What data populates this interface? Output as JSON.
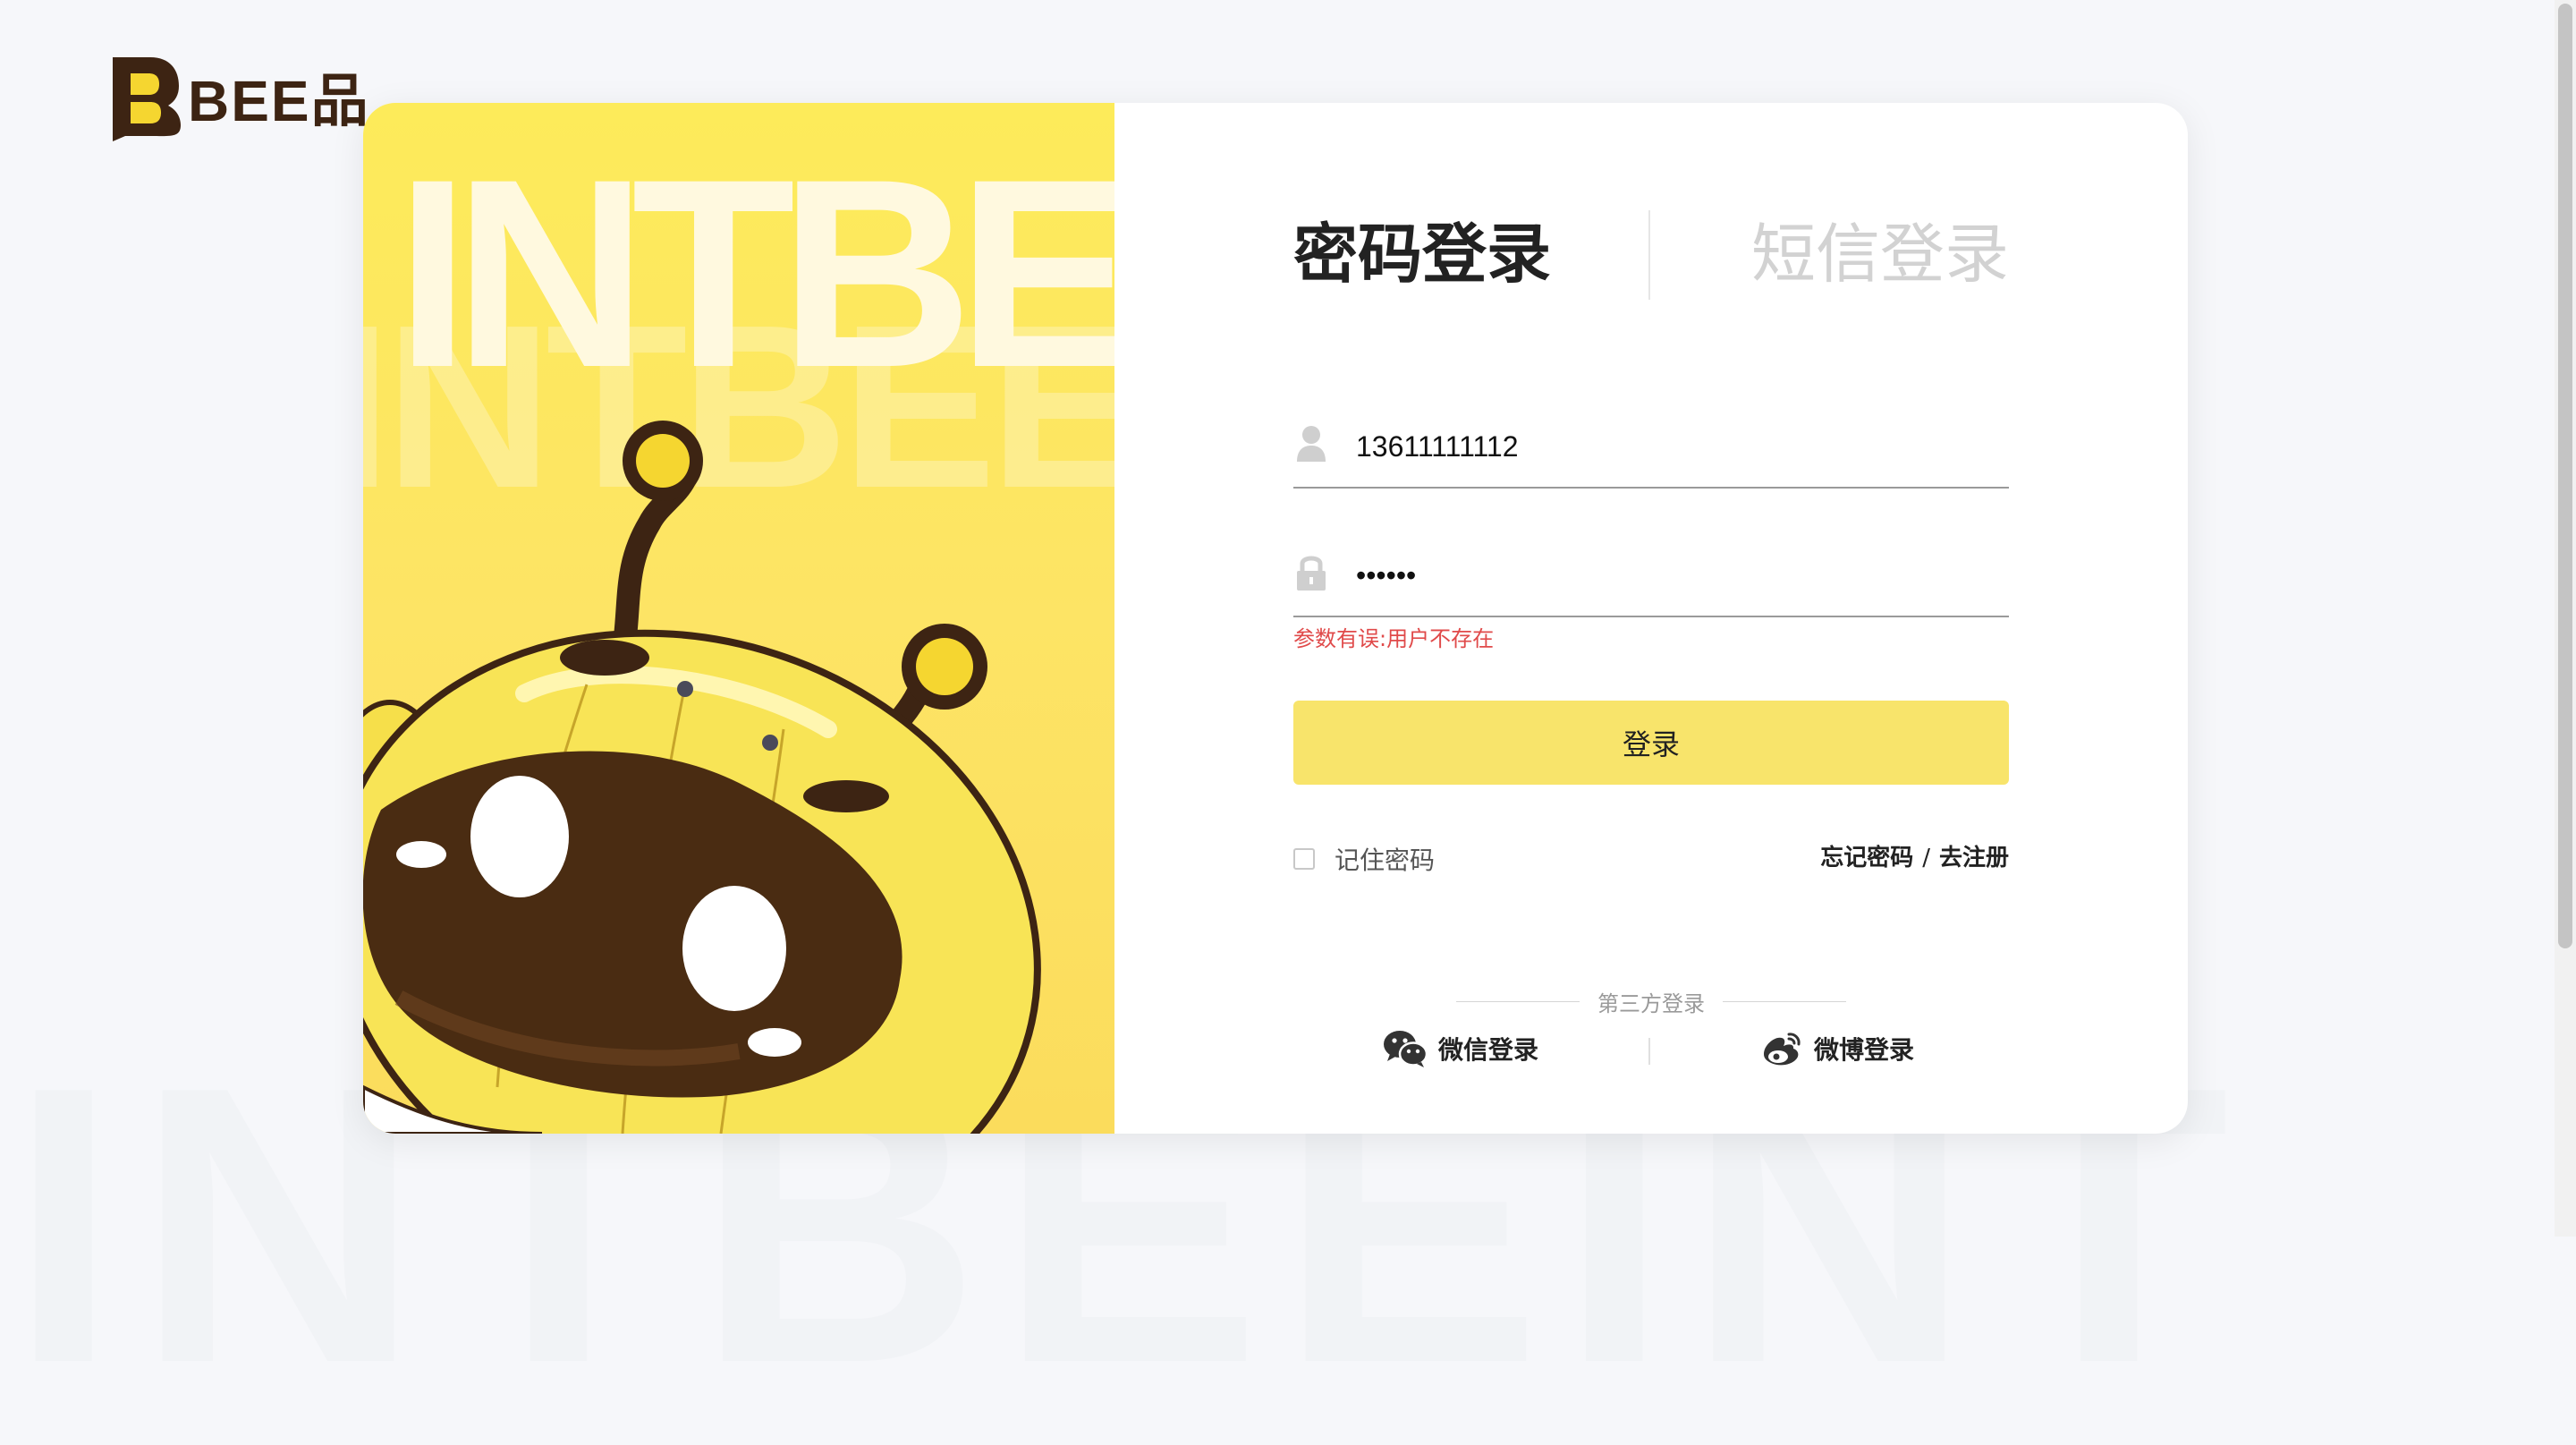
{
  "brand": {
    "name": "BEE品"
  },
  "hero": {
    "word": "INTBEE",
    "ghost_word": "INTBEE"
  },
  "background": {
    "watermark": "INTBEEINT"
  },
  "tabs": [
    {
      "label": "密码登录",
      "active": true
    },
    {
      "label": "短信登录",
      "active": false
    }
  ],
  "form": {
    "username_value": "13611111112",
    "password_value": "••••••",
    "error": "参数有误:用户不存在",
    "submit_label": "登录",
    "remember_label": "记住密码",
    "remember_checked": false,
    "forgot_label": "忘记密码",
    "link_separator": "/",
    "register_label": "去注册"
  },
  "third_party": {
    "title": "第三方登录",
    "wechat_label": "微信登录",
    "weibo_label": "微博登录"
  },
  "icons": {
    "username": "user-icon",
    "password": "lock-icon",
    "wechat": "wechat-icon",
    "weibo": "weibo-icon"
  },
  "colors": {
    "accent": "#f8e46b",
    "brand_brown": "#3d2413",
    "error": "#e04a4a",
    "hero_yellow": "#fde465"
  }
}
